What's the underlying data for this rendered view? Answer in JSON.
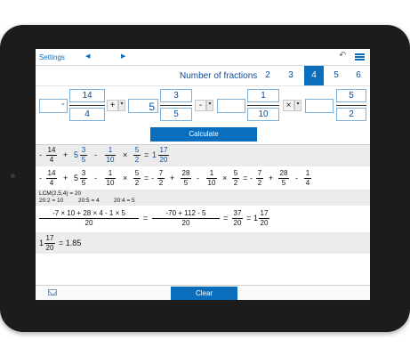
{
  "topbar": {
    "settings_label": "Settings",
    "prev_glyph": "◀",
    "next_glyph": "▶",
    "undo_glyph": "↶",
    "menu_icon": "hamburger"
  },
  "fraction_selector": {
    "label": "Number of fractions",
    "options": [
      "2",
      "3",
      "4",
      "5",
      "6"
    ],
    "selected": "4"
  },
  "inputs": {
    "f1": {
      "whole": "",
      "numerator": "14",
      "denominator": "4",
      "sign": "-"
    },
    "op1": "+",
    "f2": {
      "whole": "5",
      "numerator": "3",
      "denominator": "5"
    },
    "op2": "-",
    "f3": {
      "whole": "",
      "numerator": "1",
      "denominator": "10"
    },
    "op3": "×",
    "f4": {
      "whole": "",
      "numerator": "5",
      "denominator": "2"
    },
    "dropdown_glyph": "▾"
  },
  "calculate_label": "Calculate",
  "results": {
    "row1": {
      "tokens": [
        "-",
        "14",
        "4",
        "+",
        "5",
        "3",
        "5",
        "-",
        "1",
        "10",
        "×",
        "5",
        "2",
        "=",
        "1",
        "17",
        "20"
      ]
    },
    "row2": {
      "tokens": [
        "-",
        "14",
        "4",
        "+",
        "5",
        "3",
        "5",
        "-",
        "1",
        "10",
        "×",
        "5",
        "2",
        "=",
        "-",
        "7",
        "2",
        "+",
        "28",
        "5",
        "-",
        "1",
        "10",
        "×",
        "5",
        "2",
        "=",
        "-",
        "7",
        "2",
        "+",
        "28",
        "5",
        "-",
        "1",
        "4"
      ]
    },
    "lcm": {
      "line1": "LCM(2,5,4)  = 20",
      "line2a": "20:2 = 10",
      "line2b": "20:5 = 4",
      "line2c": "20:4 = 5"
    },
    "row4": {
      "num1": "-7 × 10  +  28 × 4  -  1 × 5",
      "den1": "20",
      "eq1": "=",
      "num2": "-70  +  112  -  5",
      "den2": "20",
      "eq2": "=",
      "num3": "37",
      "den3": "20",
      "eq3": "=",
      "whole": "1",
      "num4": "17",
      "den4": "20"
    },
    "row5": {
      "whole": "1",
      "num": "17",
      "den": "20",
      "equals": "= 1.85"
    }
  },
  "bottombar": {
    "mail_icon": "envelope",
    "clear_label": "Clear"
  },
  "colors": {
    "accent": "#0a6ebd",
    "text_blue": "#0a4b9a",
    "device": "#1c1c1c"
  }
}
